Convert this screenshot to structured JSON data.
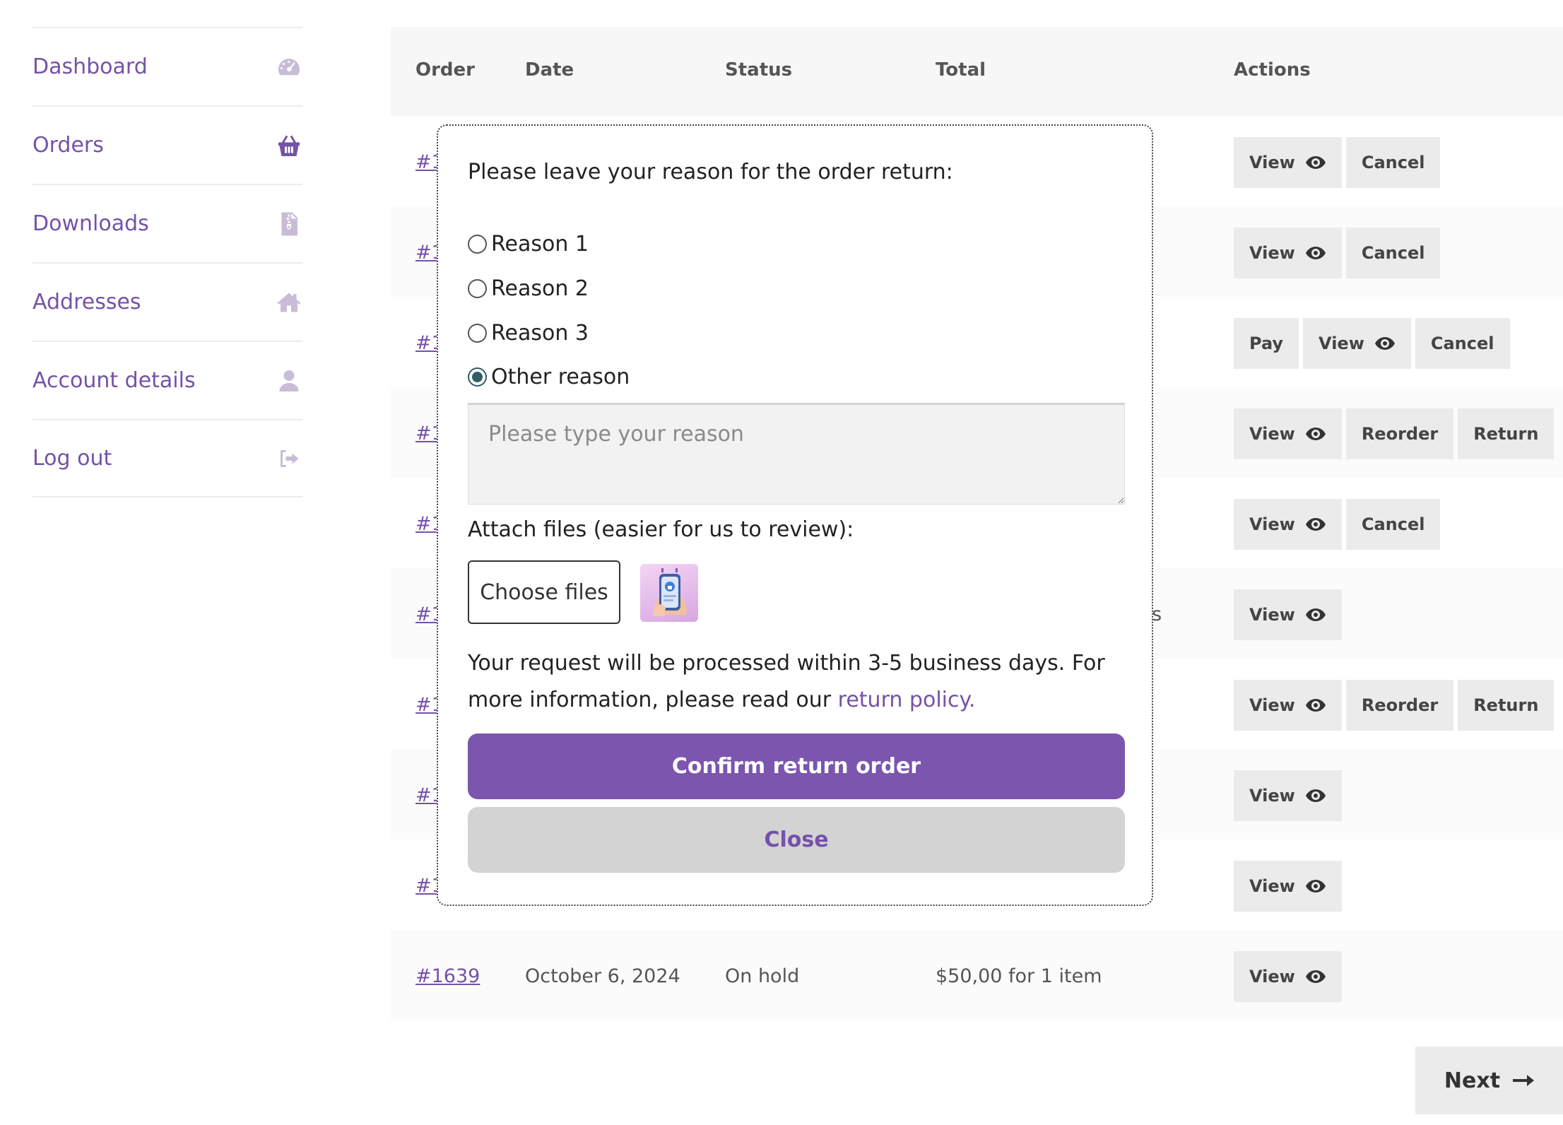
{
  "sidebar": {
    "items": [
      {
        "label": "Dashboard",
        "icon": "dashboard-icon"
      },
      {
        "label": "Orders",
        "icon": "basket-icon",
        "active": true
      },
      {
        "label": "Downloads",
        "icon": "file-download-icon"
      },
      {
        "label": "Addresses",
        "icon": "home-icon"
      },
      {
        "label": "Account details",
        "icon": "user-icon"
      },
      {
        "label": "Log out",
        "icon": "sign-out-icon"
      }
    ]
  },
  "table": {
    "headers": {
      "order": "Order",
      "date": "Date",
      "status": "Status",
      "total": "Total",
      "actions": "Actions"
    },
    "partial_order_prefix": "#1",
    "partial_total_fragment": "ns",
    "last_row": {
      "order": "#1639",
      "date": "October 6, 2024",
      "status": "On hold",
      "total": "$50,00 for 1 item"
    },
    "rows": [
      {
        "actions": [
          "View",
          "Cancel"
        ]
      },
      {
        "actions": [
          "View",
          "Cancel"
        ]
      },
      {
        "actions": [
          "Pay",
          "View",
          "Cancel"
        ]
      },
      {
        "actions": [
          "View",
          "Reorder",
          "Return"
        ]
      },
      {
        "actions": [
          "View",
          "Cancel"
        ]
      },
      {
        "actions": [
          "View"
        ]
      },
      {
        "actions": [
          "View",
          "Reorder",
          "Return"
        ]
      },
      {
        "actions": [
          "View"
        ]
      },
      {
        "actions": [
          "View"
        ]
      },
      {
        "actions": [
          "View"
        ]
      }
    ],
    "button_labels": {
      "view": "View",
      "cancel": "Cancel",
      "pay": "Pay",
      "reorder": "Reorder",
      "return": "Return"
    }
  },
  "pagination": {
    "next_label": "Next"
  },
  "modal": {
    "title": "Please leave your reason for the order return:",
    "reasons": [
      "Reason 1",
      "Reason 2",
      "Reason 3",
      "Other reason"
    ],
    "selected_reason": "Other reason",
    "reason_placeholder": "Please type your reason",
    "attach_label": "Attach files (easier for us to review):",
    "choose_files_label": "Choose files",
    "process_text": "Your request will be processed within 3-5 business days. For more information, please read our",
    "policy_link": "return policy.",
    "confirm_label": "Confirm return order",
    "close_label": "Close"
  },
  "colors": {
    "accent": "#7452a8",
    "button_bg": "#ebebeb",
    "confirm_bg": "#7b55ae",
    "close_bg": "#d3d3d3"
  }
}
